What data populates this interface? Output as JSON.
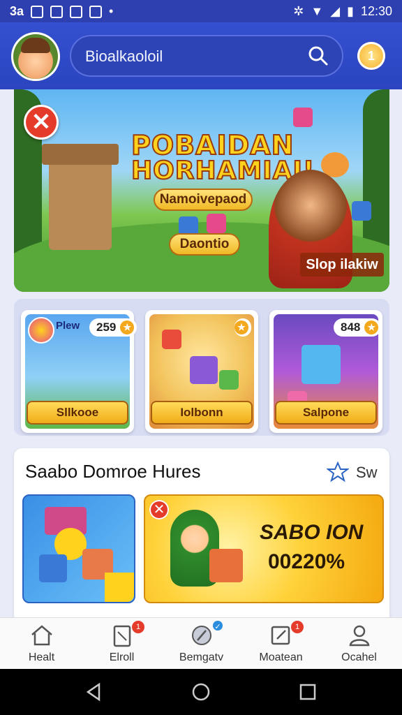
{
  "status_bar": {
    "left_text": "3a",
    "time": "12:30"
  },
  "header": {
    "search_text": "Bioalkaoloil",
    "coin_label": "1"
  },
  "banner": {
    "title_line1": "POBAIDAN",
    "title_line2": "HORHAMIAI!",
    "pill1": "Namoivepaod",
    "pill2": "Daontio",
    "play_label": "Slop ilakiw"
  },
  "game_cards": [
    {
      "tag": "Plew",
      "badge": "259",
      "label": "Sllkooe"
    },
    {
      "tag": "",
      "badge": "",
      "label": "Iolbonn"
    },
    {
      "tag": "",
      "badge": "848",
      "label": "Salpone"
    }
  ],
  "section": {
    "title": "Saabo Domroe Hures",
    "see_all": "Sw",
    "promo_line1": "SABO ION",
    "promo_line2": "00220%"
  },
  "bottom_nav": [
    {
      "label": "Healt",
      "icon": "home-icon",
      "badge": ""
    },
    {
      "label": "Elroll",
      "icon": "tablet-icon",
      "badge": "1"
    },
    {
      "label": "Bemgatv",
      "icon": "compass-icon",
      "badge": ""
    },
    {
      "label": "Moatean",
      "icon": "edit-box-icon",
      "badge": "1"
    },
    {
      "label": "Ocahel",
      "icon": "user-icon",
      "badge": ""
    }
  ],
  "colors": {
    "header": "#2e3fb0",
    "accent": "#f4a81d",
    "alert": "#e53b2a"
  }
}
